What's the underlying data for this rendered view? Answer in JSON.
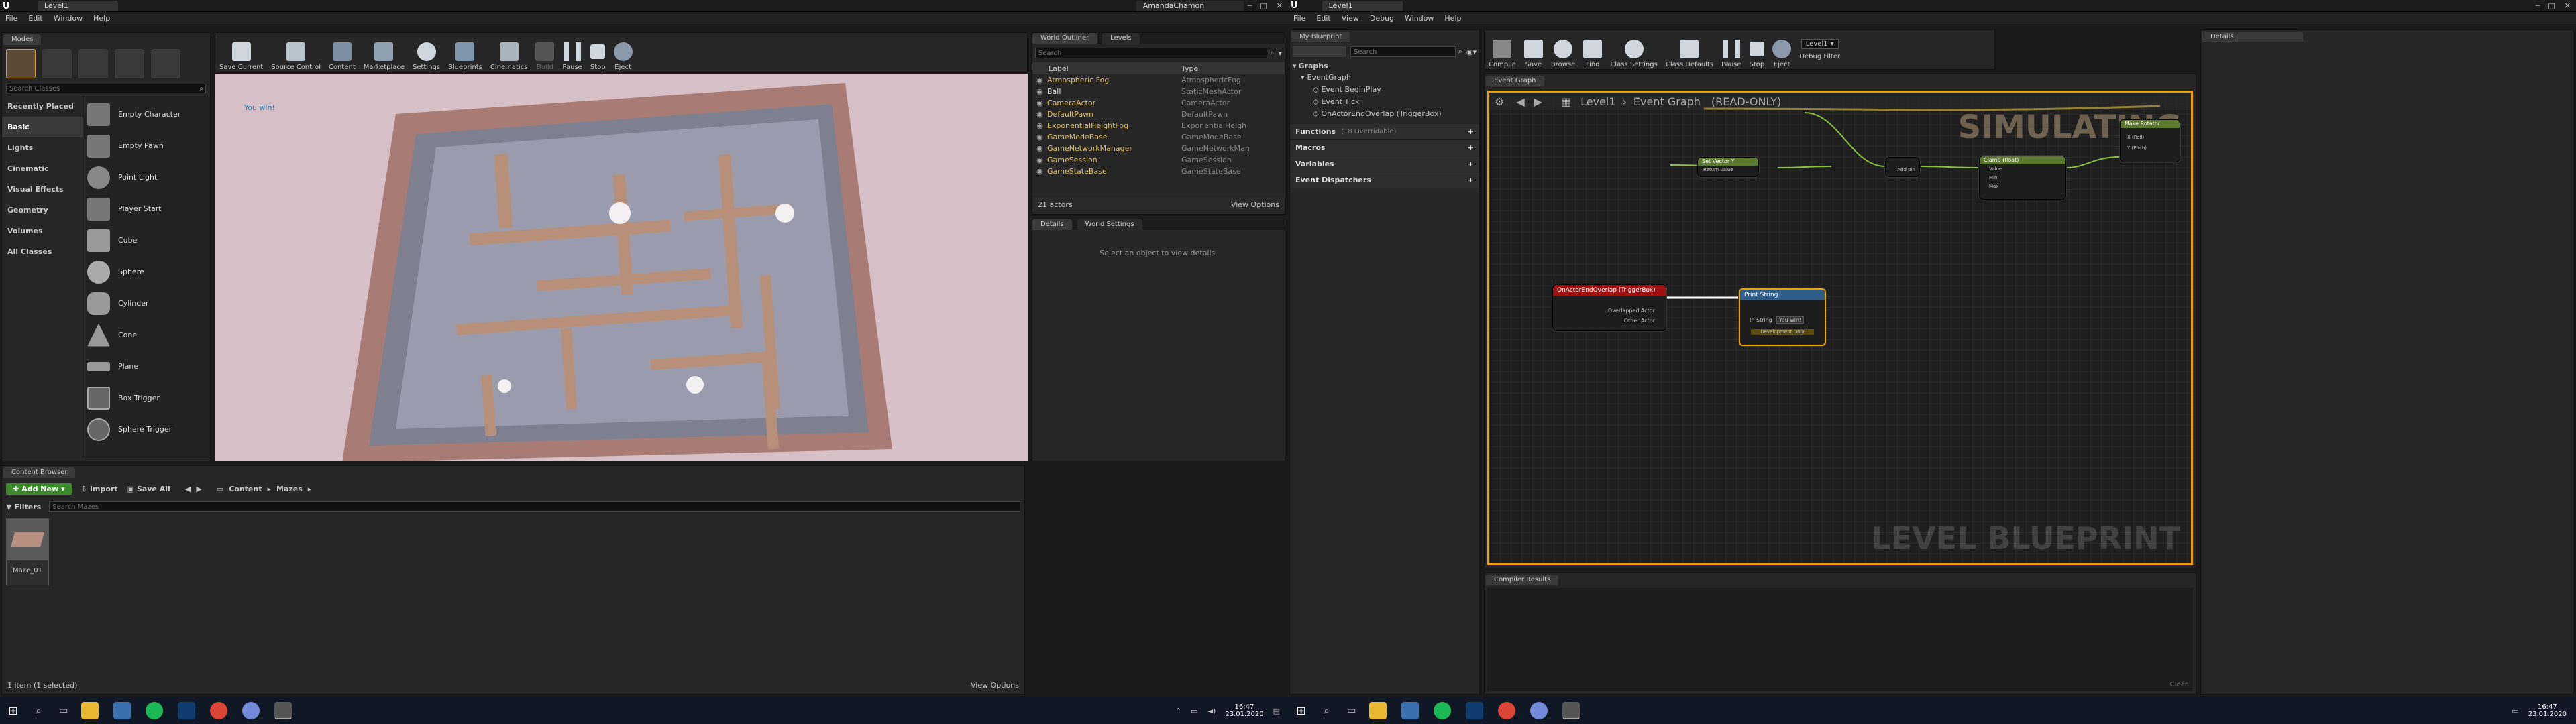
{
  "left": {
    "title_tab": "Level1",
    "user": "AmandaChamon",
    "menu": [
      "File",
      "Edit",
      "Window",
      "Help"
    ],
    "modes_tab": "Modes",
    "search_placeholder": "Search Classes",
    "categories": [
      "Recently Placed",
      "Basic",
      "Lights",
      "Cinematic",
      "Visual Effects",
      "Geometry",
      "Volumes",
      "All Classes"
    ],
    "active_category": "Basic",
    "actors": [
      "Empty Character",
      "Empty Pawn",
      "Point Light",
      "Player Start",
      "Cube",
      "Sphere",
      "Cylinder",
      "Cone",
      "Plane",
      "Box Trigger",
      "Sphere Trigger"
    ],
    "toolbar": [
      "Save Current",
      "Source Control",
      "Content",
      "Marketplace",
      "Settings",
      "Blueprints",
      "Cinematics",
      "Build",
      "Pause",
      "Stop",
      "Eject"
    ],
    "viewport_text": "You win!",
    "outliner": {
      "tab": "World Outliner",
      "tab2": "Levels",
      "search_placeholder": "Search",
      "col_label": "Label",
      "col_type": "Type",
      "rows": [
        {
          "label": "Atmospheric Fog",
          "type": "AtmosphericFog"
        },
        {
          "label": "Ball",
          "type": "StaticMeshActor"
        },
        {
          "label": "CameraActor",
          "type": "CameraActor"
        },
        {
          "label": "DefaultPawn",
          "type": "DefaultPawn"
        },
        {
          "label": "ExponentialHeightFog",
          "type": "ExponentialHeigh"
        },
        {
          "label": "GameModeBase",
          "type": "GameModeBase"
        },
        {
          "label": "GameNetworkManager",
          "type": "GameNetworkMan"
        },
        {
          "label": "GameSession",
          "type": "GameSession"
        },
        {
          "label": "GameStateBase",
          "type": "GameStateBase"
        }
      ],
      "count": "21 actors",
      "view_options": "View Options"
    },
    "details": {
      "tab": "Details",
      "tab2": "World Settings",
      "empty": "Select an object to view details."
    },
    "content_browser": {
      "tab": "Content Browser",
      "add_new": "Add New",
      "import": "Import",
      "save_all": "Save All",
      "path": [
        "Content",
        "Mazes"
      ],
      "filters": "Filters",
      "search_placeholder": "Search Mazes",
      "asset_name": "Maze_01",
      "status": "1 item (1 selected)",
      "view_options": "View Options"
    }
  },
  "right": {
    "title_tab": "Level1",
    "menu": [
      "File",
      "Edit",
      "View",
      "Debug",
      "Window",
      "Help"
    ],
    "toolbar": [
      "Compile",
      "Save",
      "Browse",
      "Find",
      "Class Settings",
      "Class Defaults",
      "Pause",
      "Stop",
      "Eject"
    ],
    "debug_filter": "Level1",
    "debug_filter_label": "Debug Filter",
    "mybp_tab": "My Blueprint",
    "search_placeholder": "Search",
    "graphs_header": "Graphs",
    "graph_items": [
      "EventGraph",
      "Event BeginPlay",
      "Event Tick",
      "OnActorEndOverlap (TriggerBox)"
    ],
    "functions": "Functions",
    "functions_count": "(18 Overridable)",
    "macros": "Macros",
    "variables": "Variables",
    "dispatchers": "Event Dispatchers",
    "graph_tab": "Event Graph",
    "breadcrumb_level": "Level1",
    "breadcrumb_graph": "Event Graph",
    "readonly": "(READ-ONLY)",
    "simulating": "SIMULATING",
    "watermark": "LEVEL BLUEPRINT",
    "nodes": {
      "event_node": "OnActorEndOverlap (TriggerBox)",
      "event_pin1": "Overlapped Actor",
      "event_pin2": "Other Actor",
      "print_node": "Print String",
      "print_pin": "In String",
      "print_value": "You win!",
      "print_dev": "Development Only",
      "set_node": "Set Vector Y",
      "set_pin": "Return Value",
      "clamp_node": "Clamp (float)",
      "clamp_pins": [
        "Value",
        "Min",
        "Max"
      ],
      "make_node": "Make Rotator",
      "make_pins": [
        "X (Roll)",
        "Y (Pitch)"
      ],
      "add_pin": "Add pin"
    },
    "compiler_tab": "Compiler Results",
    "clear": "Clear",
    "details_tab": "Details"
  },
  "taskbar": {
    "time": "16:47",
    "date": "23.01.2020"
  },
  "colors": {
    "accent_orange": "#f0a000",
    "event_red": "#a01010",
    "function_blue": "#2f5d8a",
    "pure_green": "#5c7a2e",
    "add_green": "#3a8a2a",
    "viewport_bg": "#d8c0c8"
  }
}
